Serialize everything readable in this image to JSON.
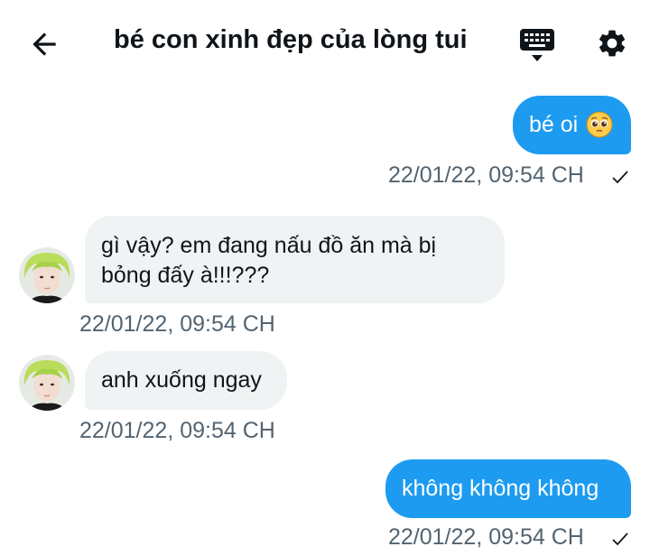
{
  "header": {
    "title": "bé con xinh đẹp của lòng tui",
    "back_icon": "arrow-left-icon",
    "keyboard_icon": "keyboard-icon",
    "settings_icon": "gear-icon"
  },
  "messages": [
    {
      "direction": "outgoing",
      "text": "bé oi",
      "emoji": "pleading-face-emoji",
      "timestamp": "22/01/22, 09:54 CH",
      "status": "sent"
    },
    {
      "direction": "incoming",
      "text": "gì vậy? em đang nấu đồ ăn mà bị bỏng đấy à!!!???",
      "timestamp": "22/01/22, 09:54 CH"
    },
    {
      "direction": "incoming",
      "text": "anh xuống ngay",
      "timestamp": "22/01/22, 09:54 CH"
    },
    {
      "direction": "outgoing",
      "text": "không không không",
      "timestamp": "22/01/22, 09:54 CH",
      "status": "sent"
    }
  ],
  "colors": {
    "outgoing_bubble": "#1d9bf0",
    "incoming_bubble": "#eff3f4",
    "timestamp": "#536471"
  }
}
